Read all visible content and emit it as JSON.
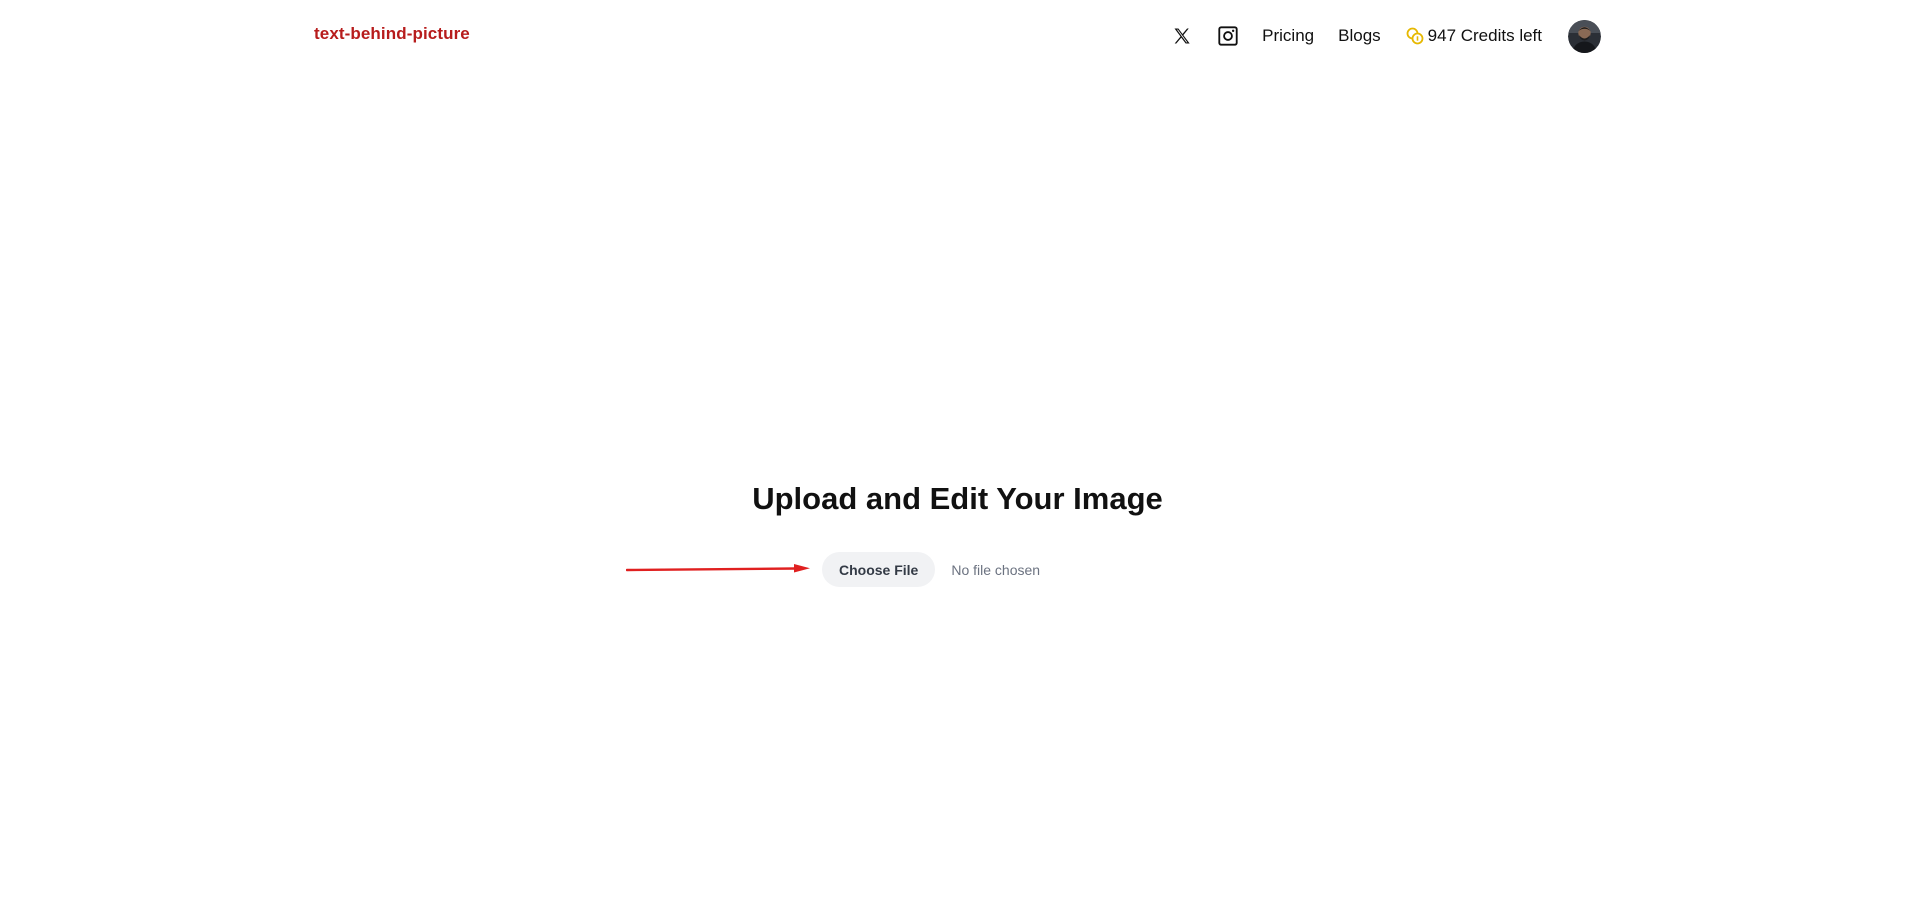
{
  "header": {
    "brand": "text-behind-picture",
    "nav": {
      "x_icon": "x-twitter-icon",
      "instagram_icon": "instagram-icon",
      "pricing_label": "Pricing",
      "blogs_label": "Blogs",
      "credits_icon": "coins-icon",
      "credits_label": "947 Credits left"
    }
  },
  "main": {
    "title": "Upload and Edit Your Image",
    "upload": {
      "button_label": "Choose File",
      "status_text": "No file chosen"
    }
  },
  "colors": {
    "brand": "#b71c1c",
    "coin": "#e6b800",
    "arrow": "#e02020",
    "button_bg": "#f1f2f4"
  }
}
